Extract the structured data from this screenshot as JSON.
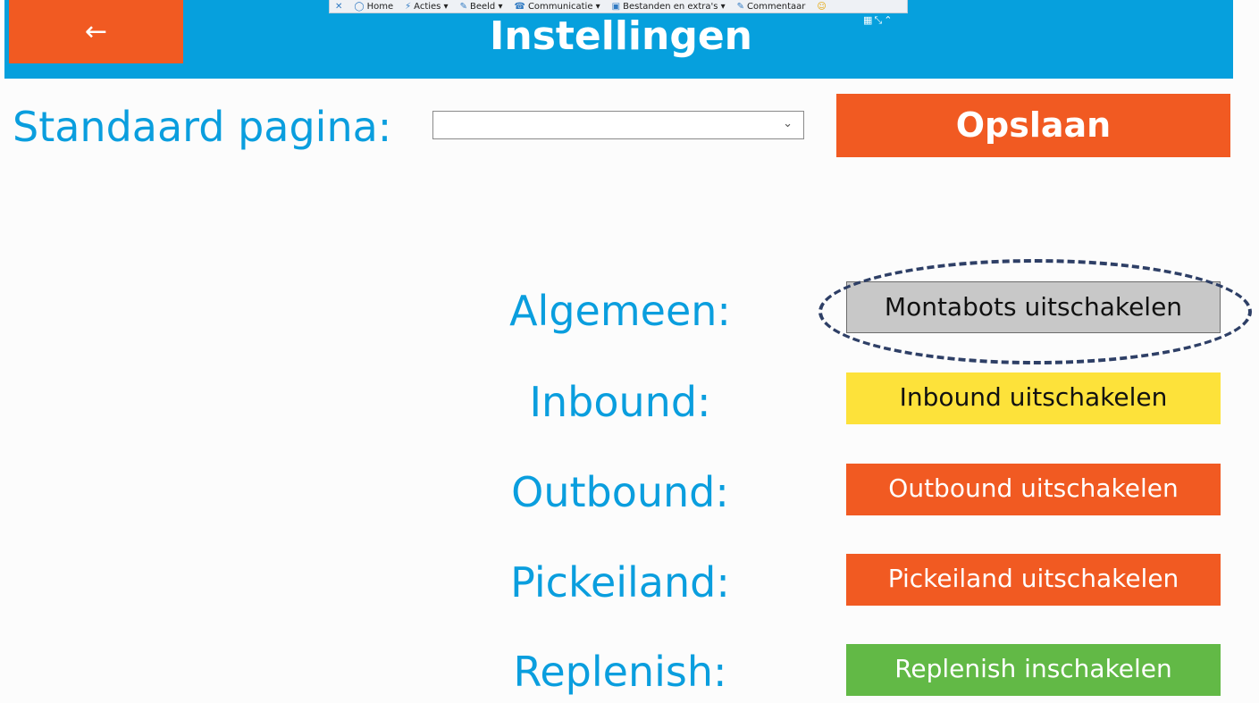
{
  "header": {
    "back_label": "←",
    "title": "Instellingen",
    "ribbon": [
      {
        "icon": "close-icon",
        "glyph": "✕",
        "label": ""
      },
      {
        "icon": "home-icon",
        "glyph": "◯",
        "label": "Home"
      },
      {
        "icon": "actions-icon",
        "glyph": "⚡",
        "label": "Acties ▾"
      },
      {
        "icon": "view-icon",
        "glyph": "✎",
        "label": "Beeld ▾"
      },
      {
        "icon": "communication-icon",
        "glyph": "☎",
        "label": "Communicatie ▾"
      },
      {
        "icon": "files-icon",
        "glyph": "▣",
        "label": "Bestanden en extra's ▾"
      },
      {
        "icon": "comment-icon",
        "glyph": "✎",
        "label": "Commentaar"
      },
      {
        "icon": "smiley-icon",
        "glyph": "☺",
        "label": ""
      }
    ]
  },
  "settings": {
    "default_page_label": "Standaard pagina:",
    "default_page_value": "",
    "save_label": "Opslaan"
  },
  "rows": [
    {
      "label": "Algemeen:",
      "button": "Montabots uitschakelen",
      "color": "#c8c8c8"
    },
    {
      "label": "Inbound:",
      "button": "Inbound uitschakelen",
      "color": "#fde23a"
    },
    {
      "label": "Outbound:",
      "button": "Outbound uitschakelen",
      "color": "#f15a22"
    },
    {
      "label": "Pickeiland:",
      "button": "Pickeiland uitschakelen",
      "color": "#f15a22"
    },
    {
      "label": "Replenish:",
      "button": "Replenish inschakelen",
      "color": "#62b946"
    }
  ],
  "colors": {
    "header": "#06a0dd",
    "accent_orange": "#f15a22",
    "label_blue": "#0a9ede"
  }
}
